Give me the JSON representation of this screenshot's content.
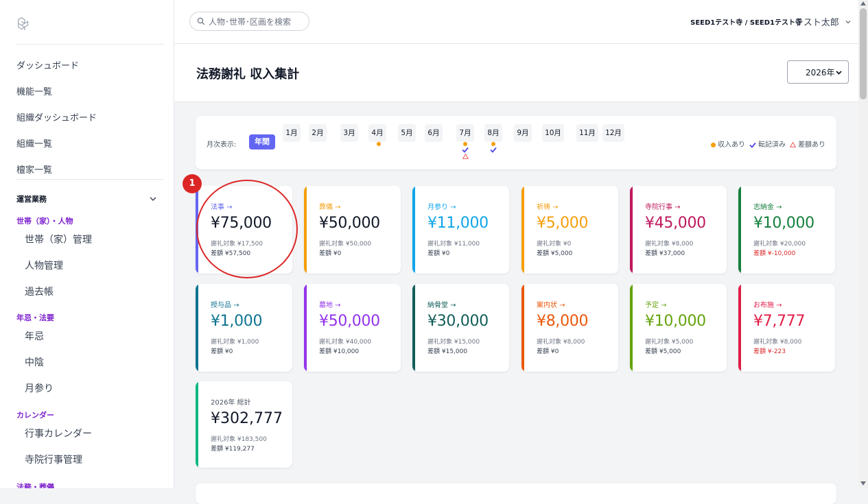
{
  "sidebar": {
    "items": [
      "ダッシュボード",
      "機能一覧",
      "組織ダッシュボード",
      "組織一覧",
      "檀家一覧"
    ],
    "section": "運営業務",
    "groups": [
      {
        "label": "世帯（家）・人物",
        "items": [
          "世帯（家）管理",
          "人物管理",
          "過去帳"
        ]
      },
      {
        "label": "年忌・法要",
        "items": [
          "年忌",
          "中陰",
          "月参り"
        ]
      },
      {
        "label": "カレンダー",
        "items": [
          "行事カレンダー",
          "寺院行事管理"
        ]
      },
      {
        "label": "法務・葬儀"
      }
    ]
  },
  "header": {
    "search_placeholder": "人物･世帯･区画を検索",
    "org": "SEED1テスト寺 / SEED1テスト寺",
    "user": "テスト太郎"
  },
  "page": {
    "title": "法務謝礼 収入集計",
    "year": "2026年"
  },
  "monthbar": {
    "label": "月次表示:",
    "annual": "年間",
    "months": [
      "1月",
      "2月",
      "3月",
      "4月",
      "5月",
      "6月",
      "7月",
      "8月",
      "9月",
      "10月",
      "11月",
      "12月"
    ],
    "legend": {
      "income": "収入あり",
      "posted": "転記済み",
      "diff": "差額あり"
    }
  },
  "cards": [
    {
      "title": "法事 →",
      "amount": "¥75,000",
      "target": "謝礼対象 ¥17,500",
      "diff": "差額 ¥57,500",
      "negative": false,
      "color": "#6366f1",
      "amount_color": "#111827"
    },
    {
      "title": "葬儀 →",
      "amount": "¥50,000",
      "target": "謝礼対象 ¥50,000",
      "diff": "差額 ¥0",
      "negative": false,
      "color": "#f59e0b",
      "amount_color": "#111827"
    },
    {
      "title": "月参り →",
      "amount": "¥11,000",
      "target": "謝礼対象 ¥11,000",
      "diff": "差額 ¥0",
      "negative": false,
      "color": "#0ea5e9",
      "amount_color": "#0ea5e9"
    },
    {
      "title": "祈祷 →",
      "amount": "¥5,000",
      "target": "謝礼対象 ¥0",
      "diff": "差額 ¥5,000",
      "negative": false,
      "color": "#f59e0b",
      "amount_color": "#f59e0b"
    },
    {
      "title": "寺院行事 →",
      "amount": "¥45,000",
      "target": "謝礼対象 ¥8,000",
      "diff": "差額 ¥37,000",
      "negative": false,
      "color": "#be185d",
      "amount_color": "#be185d"
    },
    {
      "title": "志納金 →",
      "amount": "¥10,000",
      "target": "謝礼対象 ¥20,000",
      "diff": "差額 ¥-10,000",
      "negative": true,
      "color": "#15803d",
      "amount_color": "#15803d"
    },
    {
      "title": "授与品 →",
      "amount": "¥1,000",
      "target": "謝礼対象 ¥1,000",
      "diff": "差額 ¥0",
      "negative": false,
      "color": "#0e7490",
      "amount_color": "#0e7490"
    },
    {
      "title": "墓地 →",
      "amount": "¥50,000",
      "target": "謝礼対象 ¥40,000",
      "diff": "差額 ¥10,000",
      "negative": false,
      "color": "#9333ea",
      "amount_color": "#9333ea"
    },
    {
      "title": "納骨堂 →",
      "amount": "¥30,000",
      "target": "謝礼対象 ¥15,000",
      "diff": "差額 ¥15,000",
      "negative": false,
      "color": "#115e59",
      "amount_color": "#115e59"
    },
    {
      "title": "案内状 →",
      "amount": "¥8,000",
      "target": "謝礼対象 ¥8,000",
      "diff": "差額 ¥0",
      "negative": false,
      "color": "#ea580c",
      "amount_color": "#ea580c"
    },
    {
      "title": "予定 →",
      "amount": "¥10,000",
      "target": "謝礼対象 ¥5,000",
      "diff": "差額 ¥5,000",
      "negative": false,
      "color": "#65a30d",
      "amount_color": "#65a30d"
    },
    {
      "title": "お布施 →",
      "amount": "¥7,777",
      "target": "謝礼対象 ¥8,000",
      "diff": "差額 ¥-223",
      "negative": true,
      "color": "#e11d48",
      "amount_color": "#e11d48"
    }
  ],
  "total": {
    "title": "2026年 総計",
    "amount": "¥302,777",
    "target": "謝礼対象 ¥183,500",
    "diff": "差額 ¥119,277"
  },
  "annotation": {
    "badge": "1"
  }
}
